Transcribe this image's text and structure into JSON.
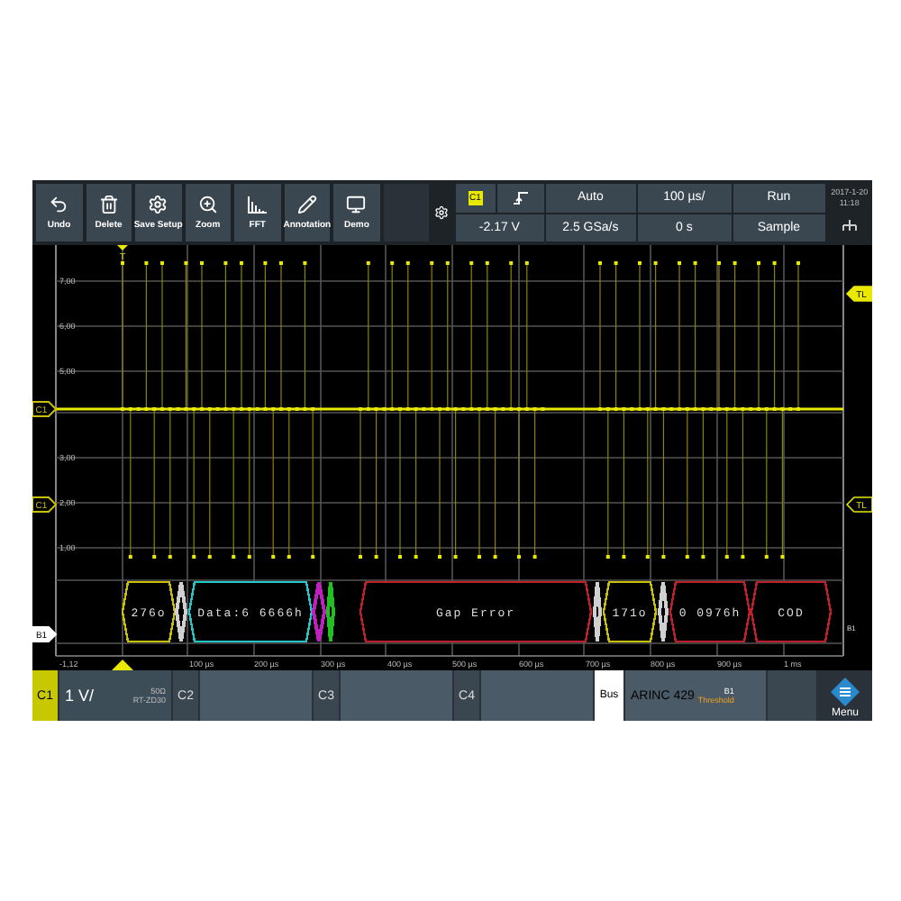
{
  "toolbar": {
    "buttons": [
      {
        "kind": "undo",
        "label": "Undo"
      },
      {
        "kind": "delete",
        "label": "Delete"
      },
      {
        "kind": "save",
        "label": "Save Setup"
      },
      {
        "kind": "zoom",
        "label": "Zoom"
      },
      {
        "kind": "fft",
        "label": "FFT"
      },
      {
        "kind": "annotation",
        "label": "Annotation"
      },
      {
        "kind": "demo",
        "label": "Demo"
      }
    ]
  },
  "trigger": {
    "source": "C1",
    "level": "-2.17 V",
    "mode": "Auto",
    "sample_rate": "2.5 GSa/s",
    "timebase": "100 µs/",
    "position": "0 s",
    "run_state": "Run",
    "acquisition": "Sample"
  },
  "datetime": [
    "2017-1-20",
    "11:18"
  ],
  "plot": {
    "y_labels": [
      "7,00",
      "6,00",
      "5,00",
      "3,00",
      "2,00",
      "1,00"
    ],
    "x_labels": [
      "-1,12",
      "100 µs",
      "200 µs",
      "300 µs",
      "400 µs",
      "500 µs",
      "600 µs",
      "700 µs",
      "800 µs",
      "900 µs",
      "1 ms"
    ],
    "left_markers": [
      {
        "kind": "channel",
        "label": "C1"
      },
      {
        "kind": "channel",
        "label": "C1"
      },
      {
        "kind": "bus",
        "label": "B1"
      }
    ],
    "right_markers": [
      {
        "label": "TL"
      },
      {
        "label": "TL"
      }
    ],
    "trigger_label": "T",
    "frames": [
      {
        "text": "276o",
        "color": "#c8c000"
      },
      {
        "color": "#d0d0d0"
      },
      {
        "text": "Data:6 6666h",
        "color": "#22c7c7"
      },
      {
        "color": "#c020c0"
      },
      {
        "color": "#20c020"
      },
      {
        "text": "Gap Error",
        "color": "#c0202a"
      },
      {
        "color": "#d0d0d0"
      },
      {
        "text": "171o",
        "color": "#c8c000"
      },
      {
        "color": "#d0d0d0"
      },
      {
        "text": "0 0976h",
        "color": "#c0202a"
      },
      {
        "text": "COD",
        "color": "#c0202a"
      }
    ],
    "bus_tag": "B1"
  },
  "channels": [
    {
      "label": "C1",
      "value": "1 V/",
      "impedance": "50Ω",
      "probe": "RT-ZD30",
      "selected": true
    },
    {
      "label": "C2",
      "selected": false
    },
    {
      "label": "C3",
      "selected": false
    },
    {
      "label": "C4",
      "selected": false
    }
  ],
  "bus": {
    "label": "Bus",
    "protocol": "ARINC 429",
    "id": "B1",
    "note": "Threshold"
  },
  "menu": "Menu"
}
